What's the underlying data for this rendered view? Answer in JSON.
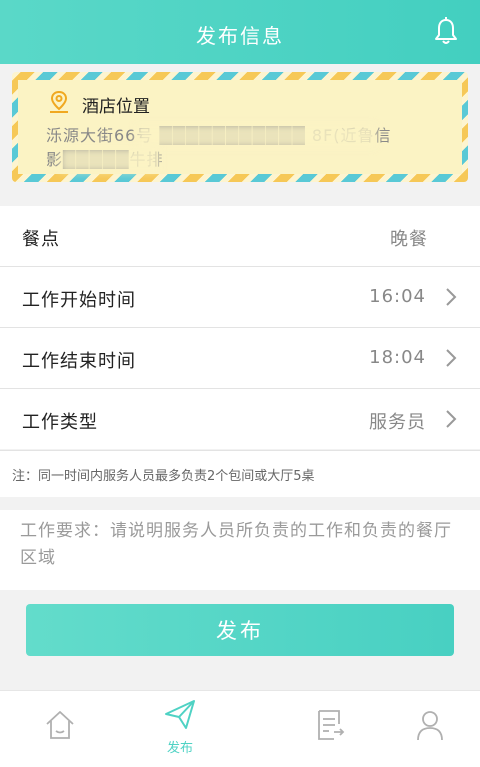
{
  "header": {
    "title": "发布信息",
    "bell_icon": "bell-icon"
  },
  "hotel_location": {
    "title": "酒店位置",
    "icon": "location-pin-icon",
    "address_line1": "泺源大街66号 ███████████ 8F(近鲁信",
    "address_line2": "影█████牛排"
  },
  "form": {
    "rows": [
      {
        "label": "餐点",
        "value": "晚餐",
        "has_arrow": false
      },
      {
        "label": "工作开始时间",
        "value": "16:04",
        "has_arrow": true
      },
      {
        "label": "工作结束时间",
        "value": "18:04",
        "has_arrow": true
      },
      {
        "label": "工作类型",
        "value": "服务员",
        "has_arrow": true
      }
    ],
    "note": "注：同一时间内服务人员最多负责2个包间或大厅5桌",
    "requirement_placeholder": "工作要求：请说明服务人员所负责的工作和负责的餐厅区域"
  },
  "publish_button": "发布",
  "tabbar": {
    "tabs": [
      {
        "name": "home",
        "icon": "home-icon",
        "label": ""
      },
      {
        "name": "publish",
        "icon": "send-icon",
        "label": "发布",
        "active": true
      },
      {
        "name": "orders",
        "icon": "list-icon",
        "label": ""
      },
      {
        "name": "profile",
        "icon": "user-icon",
        "label": ""
      }
    ]
  },
  "colors": {
    "accent": "#4fd2c4",
    "card_bg": "#fbf3c4",
    "stripe_yellow": "#f6c857",
    "stripe_teal": "#59c9d6"
  }
}
